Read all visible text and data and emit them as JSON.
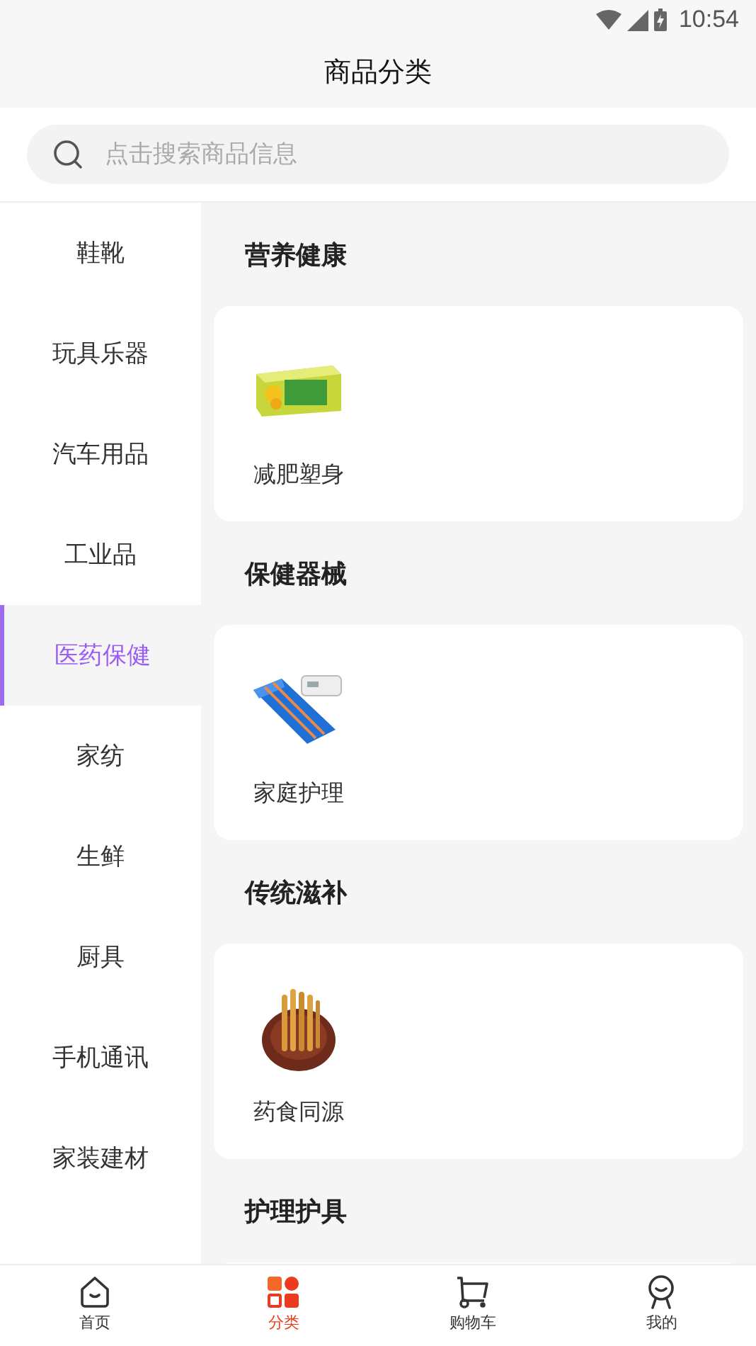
{
  "status_bar": {
    "time": "10:54"
  },
  "header": {
    "title": "商品分类"
  },
  "search": {
    "placeholder": "点击搜索商品信息"
  },
  "sidebar": {
    "items": [
      {
        "label": "鞋靴",
        "selected": false
      },
      {
        "label": "玩具乐器",
        "selected": false
      },
      {
        "label": "汽车用品",
        "selected": false
      },
      {
        "label": "工业品",
        "selected": false
      },
      {
        "label": "医药保健",
        "selected": true
      },
      {
        "label": "家纺",
        "selected": false
      },
      {
        "label": "生鲜",
        "selected": false
      },
      {
        "label": "厨具",
        "selected": false
      },
      {
        "label": "手机通讯",
        "selected": false
      },
      {
        "label": "家装建材",
        "selected": false
      }
    ]
  },
  "sections": [
    {
      "title": "营养健康",
      "items": [
        {
          "label": "减肥塑身",
          "kind": "picture"
        }
      ]
    },
    {
      "title": "保健器械",
      "items": [
        {
          "label": "家庭护理",
          "kind": "picture"
        }
      ]
    },
    {
      "title": "传统滋补",
      "items": [
        {
          "label": "药食同源",
          "kind": "picture"
        }
      ]
    },
    {
      "title": "护理护具"
    }
  ],
  "tab_bar": {
    "items": [
      {
        "label": "首页",
        "kind": "home",
        "selected": false
      },
      {
        "label": "分类",
        "kind": "category",
        "selected": true
      },
      {
        "label": "购物车",
        "kind": "cart",
        "selected": false
      },
      {
        "label": "我的",
        "kind": "me",
        "selected": false
      }
    ]
  }
}
